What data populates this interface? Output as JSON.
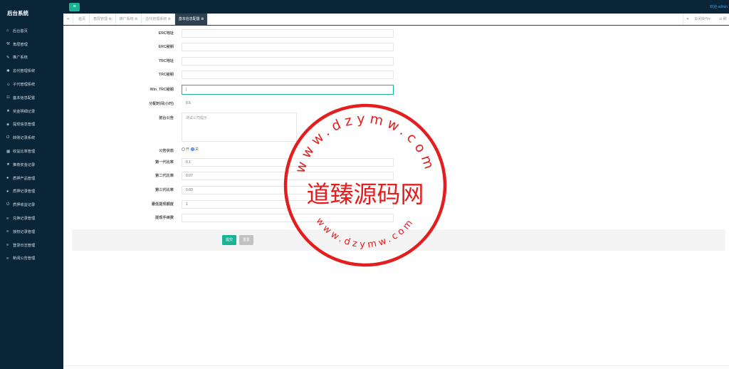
{
  "sidebar": {
    "brand": "后台系统",
    "items": [
      {
        "icon": "home-icon",
        "glyph": "⌂",
        "label": "后台首页"
      },
      {
        "icon": "wrench-icon",
        "glyph": "⚒",
        "label": "角层管理"
      },
      {
        "icon": "edit-icon",
        "glyph": "✎",
        "label": "推广系统"
      },
      {
        "icon": "asterisk-icon",
        "glyph": "✱",
        "label": "总代管理系统"
      },
      {
        "icon": "users-icon",
        "glyph": "☺",
        "label": "子代管理系统"
      },
      {
        "icon": "file-icon",
        "glyph": "☷",
        "label": "基本信息配置"
      },
      {
        "icon": "star-icon",
        "glyph": "★",
        "label": "奖金明细记录"
      },
      {
        "icon": "tag-icon",
        "glyph": "◈",
        "label": "提现信息管理"
      },
      {
        "icon": "power-icon",
        "glyph": "⏻",
        "label": "转账记录系统"
      },
      {
        "icon": "calendar-icon",
        "glyph": "▦",
        "label": "收益比率管理"
      },
      {
        "icon": "star-icon",
        "glyph": "★",
        "label": "推荐奖金记录"
      },
      {
        "icon": "chat-icon",
        "glyph": "●",
        "label": "质押产品管理"
      },
      {
        "icon": "user-icon",
        "glyph": "●",
        "label": "质押记录管理"
      },
      {
        "icon": "power-icon",
        "glyph": "⏻",
        "label": "质押收益记录"
      },
      {
        "icon": "list-icon",
        "glyph": "≡",
        "label": "兑换记录管理"
      },
      {
        "icon": "list-icon",
        "glyph": "≡",
        "label": "授权记录管理"
      },
      {
        "icon": "list-icon",
        "glyph": "≡",
        "label": "登录日志管理"
      },
      {
        "icon": "list-icon",
        "glyph": "≡",
        "label": "新闻公告管理"
      }
    ]
  },
  "topbar": {
    "toggle_glyph": "≡",
    "welcome": "欢迎 admin"
  },
  "tabs": {
    "left_nav": "«",
    "right_nav": "»",
    "items": [
      {
        "label": "首页",
        "active": false
      },
      {
        "label": "角层管理 ⊗",
        "active": false
      },
      {
        "label": "推广系统 ⊗",
        "active": false
      },
      {
        "label": "总代管理系统 ⊗",
        "active": false
      },
      {
        "label": "基本信息配置 ⊗",
        "active": true
      }
    ],
    "close_ops": "关闭操作▾",
    "refresh": "⇄ 刷"
  },
  "form": {
    "erc_address": {
      "label": "ERC地址",
      "value": ""
    },
    "erc_key": {
      "label": "ERC秘钥",
      "value": ""
    },
    "trc_address": {
      "label": "TRC地址",
      "value": ""
    },
    "trc_key": {
      "label": "TRC秘钥",
      "value": ""
    },
    "win_trc_key": {
      "label": "Win_TRC秘钥",
      "value": "|"
    },
    "dist_time": {
      "label": "分配时间(小时)",
      "value": "0.5"
    },
    "notice": {
      "label": "前台公告",
      "value": "测试公司提示"
    },
    "notice_status": {
      "label": "公告状态",
      "off": "开",
      "on": "关",
      "selected": "on"
    },
    "rate1": {
      "label": "第一代比率",
      "value": "0.1"
    },
    "rate2": {
      "label": "第二代比率",
      "value": "0.07"
    },
    "rate3": {
      "label": "第三代比率",
      "value": "0.03"
    },
    "min_withdraw": {
      "label": "最低提现额度",
      "value": "1"
    },
    "withdraw_fee": {
      "label": "提现手续费",
      "value": ""
    }
  },
  "buttons": {
    "submit": "提交",
    "reset": "重置"
  },
  "watermark": {
    "center": "道臻源码网",
    "top_arc": "www.dzymw.com",
    "bottom_arc": "www.dzymw.com",
    "color": "#e41e1e"
  }
}
